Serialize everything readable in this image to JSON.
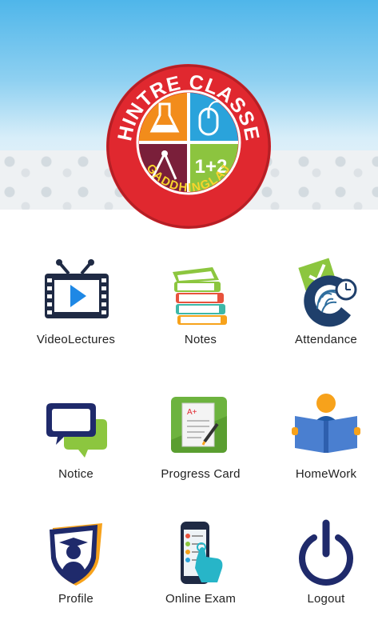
{
  "header": {
    "logo": {
      "brand_top": "SHINTRE CLASSES",
      "brand_bottom": "GADDHINGLAJ",
      "quadrant_text": "1+2"
    }
  },
  "menu": [
    {
      "label": "VideoLectures",
      "icon": "video-tv-icon"
    },
    {
      "label": "Notes",
      "icon": "books-stack-icon"
    },
    {
      "label": "Attendance",
      "icon": "fingerprint-clock-icon"
    },
    {
      "label": "Notice",
      "icon": "chat-bubbles-icon"
    },
    {
      "label": "Progress Card",
      "icon": "report-card-icon"
    },
    {
      "label": "HomeWork",
      "icon": "reading-student-icon"
    },
    {
      "label": "Profile",
      "icon": "graduate-shield-icon"
    },
    {
      "label": "Online Exam",
      "icon": "phone-touch-icon"
    },
    {
      "label": "Logout",
      "icon": "power-icon"
    }
  ],
  "colors": {
    "header_sky": "#4fb6ea",
    "logo_red": "#e0282f",
    "logo_navy": "#1f2a6b"
  }
}
